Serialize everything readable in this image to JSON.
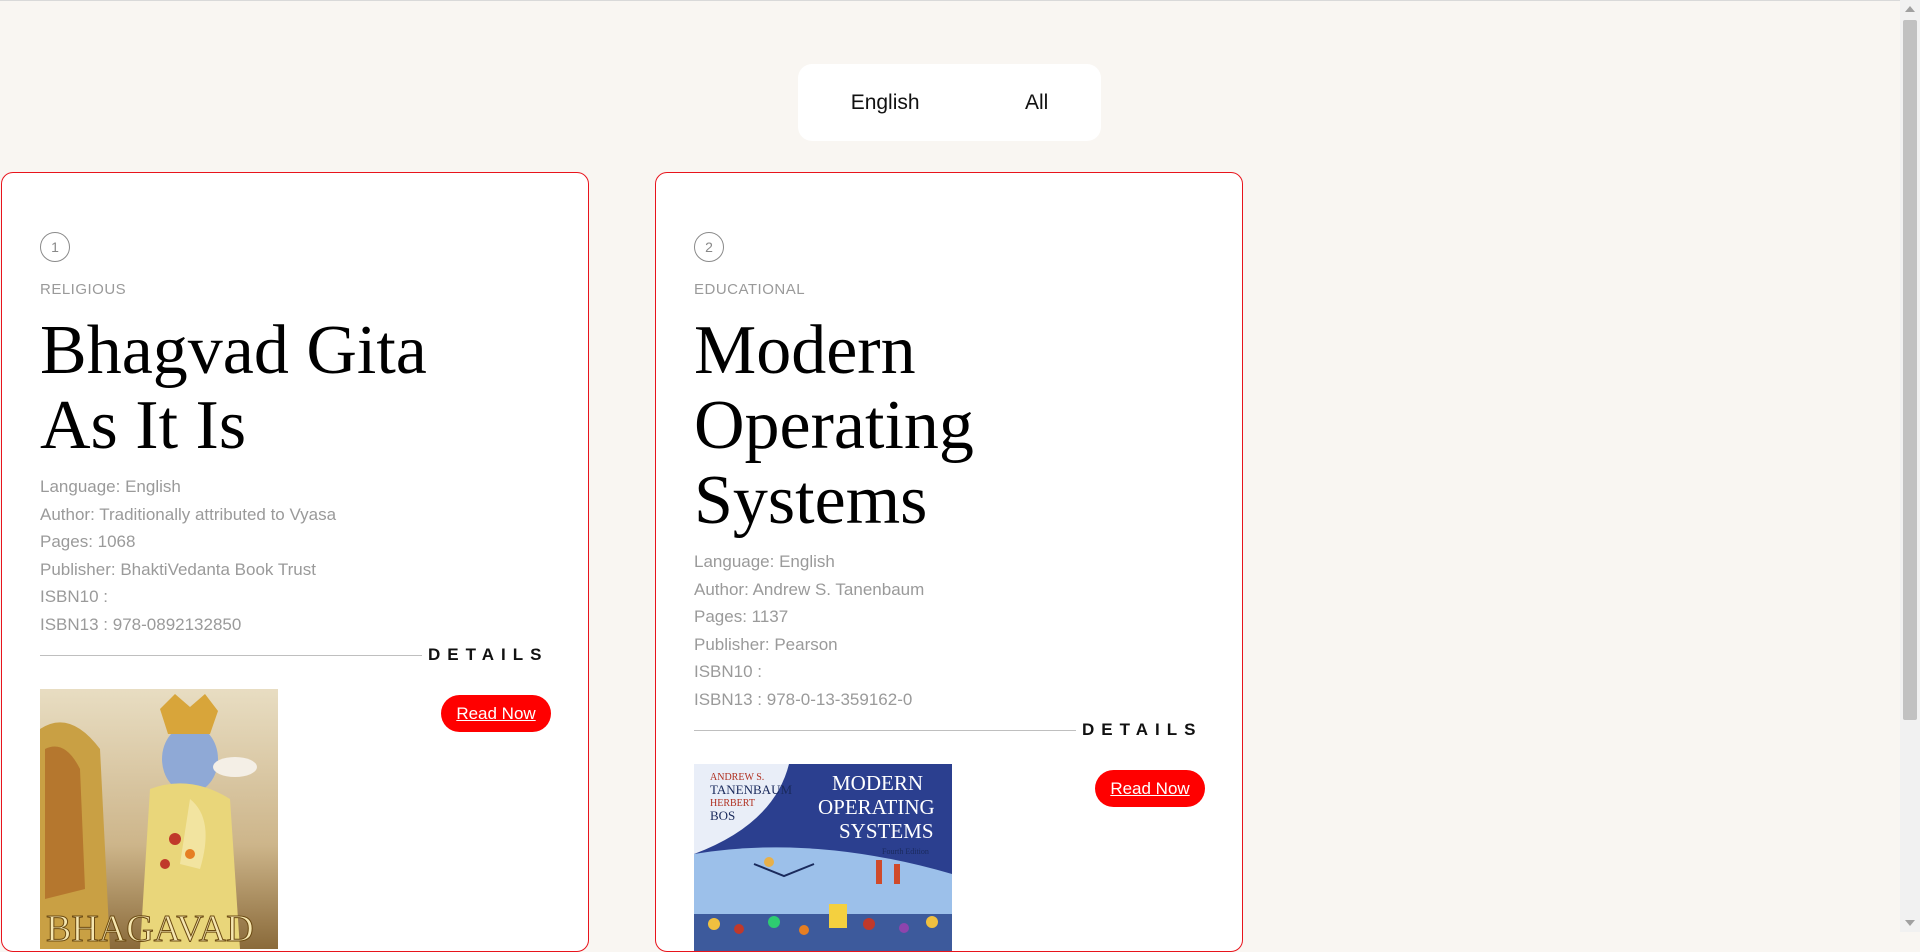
{
  "filters": {
    "english_label": "English",
    "all_label": "All"
  },
  "books": [
    {
      "number": "1",
      "category": "RELIGIOUS",
      "title_lines": [
        "Bhagvad Gita",
        "As It Is"
      ],
      "language": "Language: English",
      "author": "Author: Traditionally attributed to Vyasa",
      "pages": "Pages: 1068",
      "publisher": "Publisher: BhaktiVedanta Book Trust",
      "isbn10": "ISBN10 :",
      "isbn13": "ISBN13 : 978-0892132850",
      "details_label": "DETAILS",
      "read_label": "Read Now",
      "cover_text": "BHAGAVAD"
    },
    {
      "number": "2",
      "category": "EDUCATIONAL",
      "title_lines": [
        "Modern",
        "Operating",
        "Systems"
      ],
      "language": "Language: English",
      "author": "Author: Andrew S. Tanenbaum",
      "pages": "Pages: 1137",
      "publisher": "Publisher: Pearson",
      "isbn10": "ISBN10 :",
      "isbn13": "ISBN13 : 978-0-13-359162-0",
      "details_label": "DETAILS",
      "read_label": "Read Now",
      "cover_authors": [
        "ANDREW S.",
        "TANENBAUM",
        "HERBERT",
        "BOS"
      ],
      "cover_title": [
        "MODERN",
        "OPERATING",
        "SYSTEMS"
      ],
      "cover_edition": "Fourth Edition"
    }
  ],
  "colors": {
    "accent": "#ff0000",
    "card_border": "#e8141c",
    "page_bg": "#f9f6f2",
    "meta_text": "#9a9a9a"
  }
}
